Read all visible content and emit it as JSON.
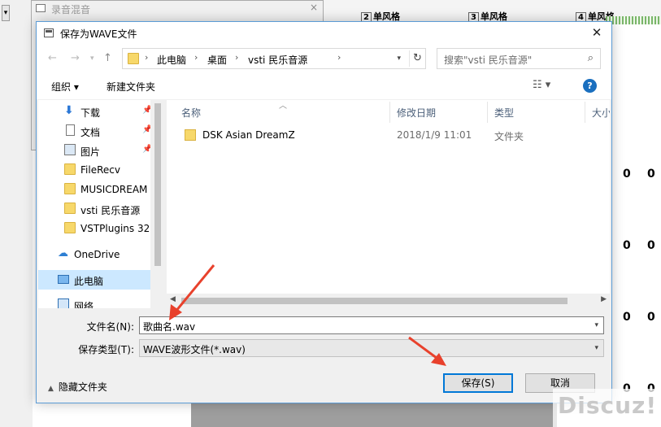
{
  "background": {
    "mixer_title": "录音混音",
    "mixer_close": "×",
    "left_button": "▾",
    "tracks": [
      {
        "num": "2",
        "label": "单风格"
      },
      {
        "num": "3",
        "label": "单风格"
      },
      {
        "num": "4",
        "label": "单风格"
      }
    ],
    "zeros": [
      "0",
      "0",
      "0",
      "0",
      "0",
      "0",
      "0",
      "0"
    ],
    "watermark": "Discuz!"
  },
  "dialog": {
    "title": "保存为WAVE文件",
    "close": "✕",
    "nav": {
      "back": "←",
      "forward": "→",
      "up": "↑"
    },
    "breadcrumb": [
      "此电脑",
      "桌面",
      "vsti 民乐音源"
    ],
    "breadcrumb_sep": "›",
    "refresh": "↻",
    "search_placeholder": "搜索\"vsti 民乐音源\"",
    "search_icon": "⌕",
    "toolbar": {
      "organize": "组织 ▾",
      "new_folder": "新建文件夹",
      "view": "☷ ▾",
      "help": "?"
    },
    "nav_items": [
      {
        "label": "下载",
        "icon": "download-icon",
        "pinned": true
      },
      {
        "label": "文档",
        "icon": "document-icon",
        "pinned": true
      },
      {
        "label": "图片",
        "icon": "pictures-icon",
        "pinned": true
      },
      {
        "label": "FileRecv",
        "icon": "folder-icon",
        "pinned": false
      },
      {
        "label": "MUSICDREAM",
        "icon": "folder-icon",
        "pinned": false
      },
      {
        "label": "vsti 民乐音源",
        "icon": "folder-icon",
        "pinned": false
      },
      {
        "label": "VSTPlugins 32",
        "icon": "folder-icon",
        "pinned": false
      },
      {
        "label": "OneDrive",
        "icon": "onedrive-icon",
        "pinned": false
      },
      {
        "label": "此电脑",
        "icon": "this-pc-icon",
        "pinned": false,
        "selected": true
      },
      {
        "label": "网络",
        "icon": "network-icon",
        "pinned": false
      }
    ],
    "pin_glyph": "📌",
    "columns": {
      "name": "名称",
      "modified": "修改日期",
      "type": "类型",
      "size": "大小"
    },
    "files": [
      {
        "name": "DSK Asian DreamZ",
        "modified": "2018/1/9 11:01",
        "type": "文件夹"
      }
    ],
    "filename_label": "文件名(N):",
    "filename_value": "歌曲名.wav",
    "filetype_label": "保存类型(T):",
    "filetype_value": "WAVE波形文件(*.wav)",
    "hide_folders": "隐藏文件夹",
    "save_button": "保存(S)",
    "cancel_button": "取消"
  },
  "colors": {
    "accent": "#0078d7",
    "selection": "#cce8ff",
    "arrow": "#e8412c",
    "folder": "#f7d86a"
  }
}
